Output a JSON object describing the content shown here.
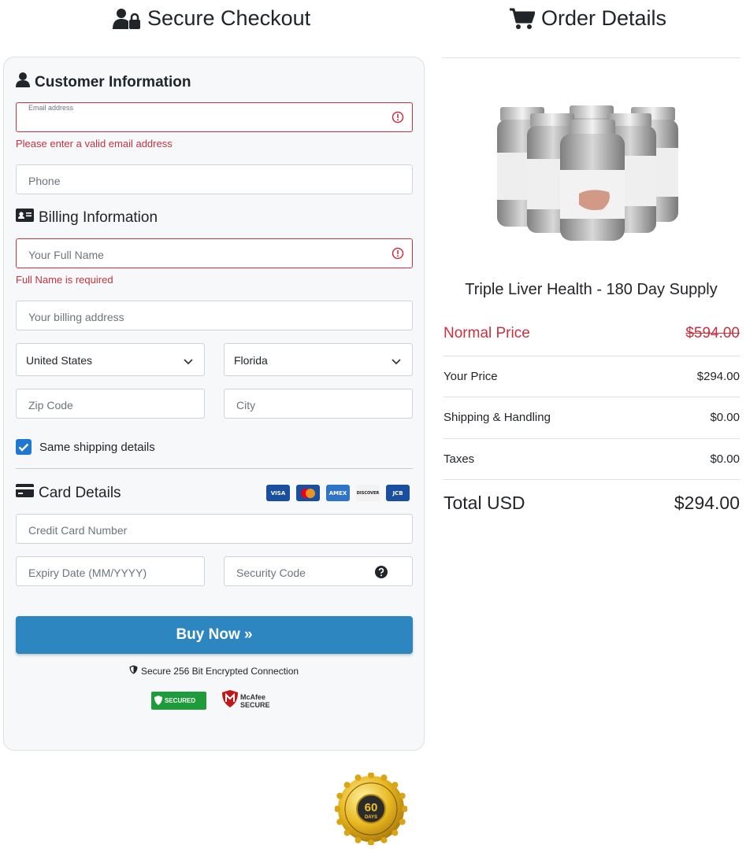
{
  "headings": {
    "secure_checkout": "Secure Checkout",
    "order_details": "Order Details"
  },
  "customer": {
    "title": "Customer Information",
    "email_label": "Email address",
    "email_error": "Please enter a valid email address",
    "phone_placeholder": "Phone"
  },
  "billing": {
    "title": "Billing Information",
    "name_placeholder": "Your Full Name",
    "name_error": "Full Name is required",
    "address_placeholder": "Your billing address",
    "country": "United States",
    "state": "Florida",
    "zip_placeholder": "Zip Code",
    "city_placeholder": "City",
    "same_shipping_label": "Same shipping details",
    "same_shipping_checked": true
  },
  "card": {
    "title": "Card Details",
    "brands": [
      "VISA",
      "MC",
      "AMEX",
      "DISCOVER",
      "JCB"
    ],
    "number_placeholder": "Credit Card Number",
    "expiry_placeholder": "Expiry Date (MM/YYYY)",
    "cvv_placeholder": "Security Code"
  },
  "buy_button": "Buy Now »",
  "secure_note": "Secure 256 Bit Encrypted Connection",
  "badges": {
    "trustguard": "SECURED",
    "mcafee_line1": "McAfee",
    "mcafee_line2": "SECURE"
  },
  "order": {
    "product_name": "Triple Liver Health - 180 Day Supply",
    "normal_price_label": "Normal Price",
    "normal_price": "$594.00",
    "your_price_label": "Your Price",
    "your_price": "$294.00",
    "shipping_label": "Shipping & Handling",
    "shipping": "$0.00",
    "taxes_label": "Taxes",
    "taxes": "$0.00",
    "total_label": "Total USD",
    "total": "$294.00"
  },
  "guarantee": {
    "days": "60",
    "days_label": "DAYS"
  },
  "colors": {
    "accent": "#2e86c1",
    "error": "#c8323f",
    "checkbox": "#1f76d3"
  }
}
